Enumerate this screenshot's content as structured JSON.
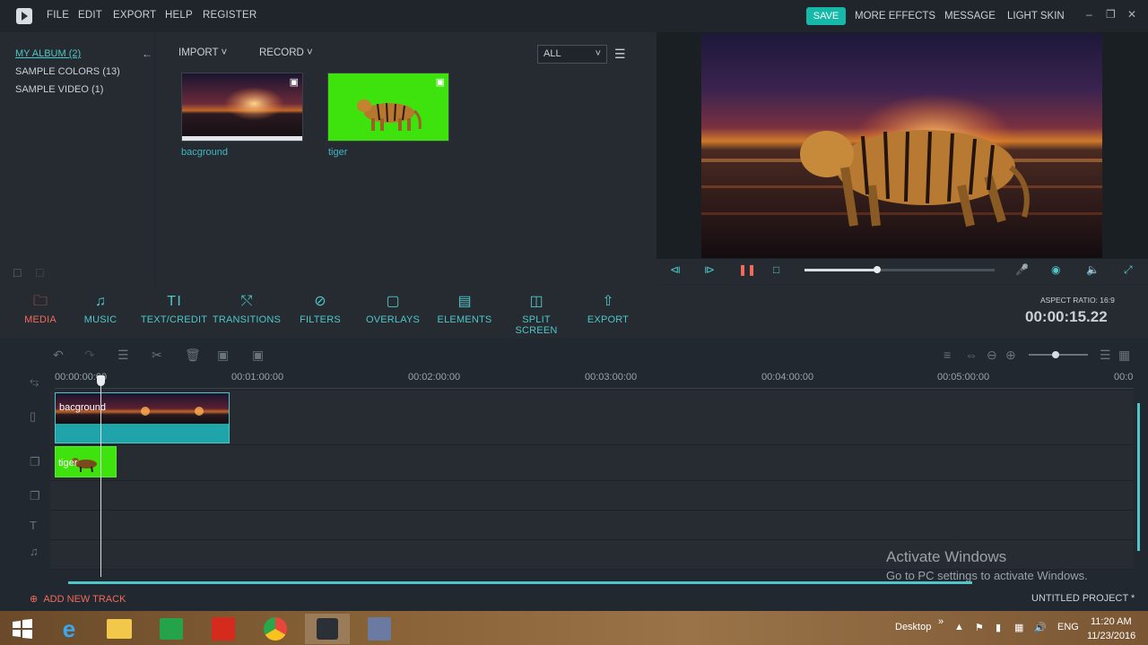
{
  "menu": {
    "items": [
      "FILE",
      "EDIT",
      "EXPORT",
      "HELP",
      "REGISTER"
    ],
    "save": "SAVE",
    "right": [
      "MORE EFFECTS",
      "MESSAGE",
      "LIGHT SKIN"
    ]
  },
  "album": {
    "items": [
      "MY ALBUM (2)",
      "SAMPLE COLORS (13)",
      "SAMPLE VIDEO (1)"
    ]
  },
  "library": {
    "import": "IMPORT",
    "record": "RECORD",
    "filter": "ALL",
    "media": [
      {
        "name": "bacground"
      },
      {
        "name": "tiger"
      }
    ]
  },
  "player": {
    "progress": 0.38
  },
  "tabs": [
    "MEDIA",
    "MUSIC",
    "TEXT/CREDIT",
    "TRANSITIONS",
    "FILTERS",
    "OVERLAYS",
    "ELEMENTS",
    "SPLIT SCREEN",
    "EXPORT"
  ],
  "timecode": {
    "aspect": "ASPECT RATIO: 16:9",
    "time": "00:00:15.22"
  },
  "timeline": {
    "ruler": [
      "00:00:00:00",
      "00:01:00:00",
      "00:02:00:00",
      "00:03:00:00",
      "00:04:00:00",
      "00:05:00:00",
      "00:0"
    ],
    "clips": {
      "video": "bacground",
      "overlay": "tiger"
    },
    "add_track": "ADD NEW TRACK",
    "project": "UNTITLED PROJECT *"
  },
  "watermark": {
    "line1": "Activate Windows",
    "line2": "Go to PC settings to activate Windows."
  },
  "taskbar": {
    "desktop": "Desktop",
    "lang": "ENG",
    "time": "11:20 AM",
    "date": "11/23/2016"
  },
  "colors": {
    "accent": "#4fc7c9",
    "active_tab": "#f26a5c",
    "save": "#16b9a8",
    "green_screen": "#3ee20c"
  }
}
